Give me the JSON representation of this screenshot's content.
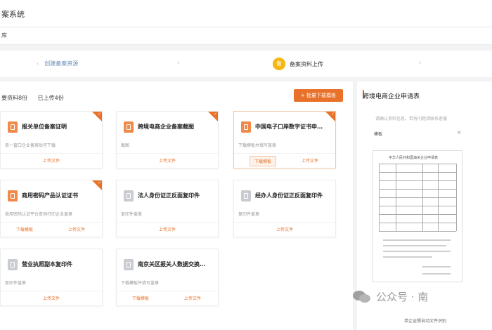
{
  "header": {
    "title": "案系统"
  },
  "breadcrumb": {
    "label": "库"
  },
  "steps": {
    "step1_label": "创建备案资源",
    "step2_badge": "备",
    "step2_label": "备案资料上传"
  },
  "stats": {
    "required": "要资料8份",
    "uploaded": "已上传4份"
  },
  "download_all_label": "+ 批量下载模板",
  "cards": [
    {
      "title": "报关单位备案证明",
      "desc": "单一窗口企业备案后可下载",
      "actions": [
        "上传文件"
      ],
      "icon": "orange-doc-icon",
      "done": true
    },
    {
      "title": "跨境电商企业备案截图",
      "desc": "截图",
      "actions": [
        "上传文件"
      ],
      "icon": "orange-doc-icon",
      "done": true
    },
    {
      "title": "中国电子口岸数字证书申…",
      "desc": "下载模板并填写盖章",
      "actions": [
        "下载模板",
        "上传文件"
      ],
      "icon": "orange-doc-icon",
      "done": true
    },
    {
      "title": "商用密码产品认证证书",
      "desc": "商用密码认证平台查询打印企业盖章",
      "actions": [
        "下载模板",
        "上传文件"
      ],
      "icon": "orange-doc-icon",
      "done": true
    },
    {
      "title": "法人身份证正反面复印件",
      "desc": "复印件盖章",
      "actions": [
        "上传文件"
      ],
      "icon": "gray-doc-icon",
      "done": false
    },
    {
      "title": "经办人身份证正反面复印件",
      "desc": "复印件盖章",
      "actions": [
        "上传文件"
      ],
      "icon": "gray-doc-icon",
      "done": false
    },
    {
      "title": "营业执照副本复印件",
      "desc": "复印件盖章",
      "actions": [
        "上传文件"
      ],
      "icon": "gray-doc-icon",
      "done": false
    },
    {
      "title": "南京关区报关人数据交换…",
      "desc": "下载模板并填写盖章",
      "actions": [
        "下载模板",
        "上传文件"
      ],
      "icon": "gray-doc-icon",
      "done": false
    }
  ],
  "side": {
    "title": "跨境电商企业申请表",
    "note": "请确认资料信息，若有问题请联系客服",
    "preview_label": "模板",
    "close": "×",
    "doc_title": "中华人民共和国海关企业申请表",
    "bottom_note": "单企证照自动文件识别"
  },
  "watermark": "公众号 · 南",
  "colors": {
    "accent": "#e8722a",
    "badge": "#f6b50f"
  }
}
